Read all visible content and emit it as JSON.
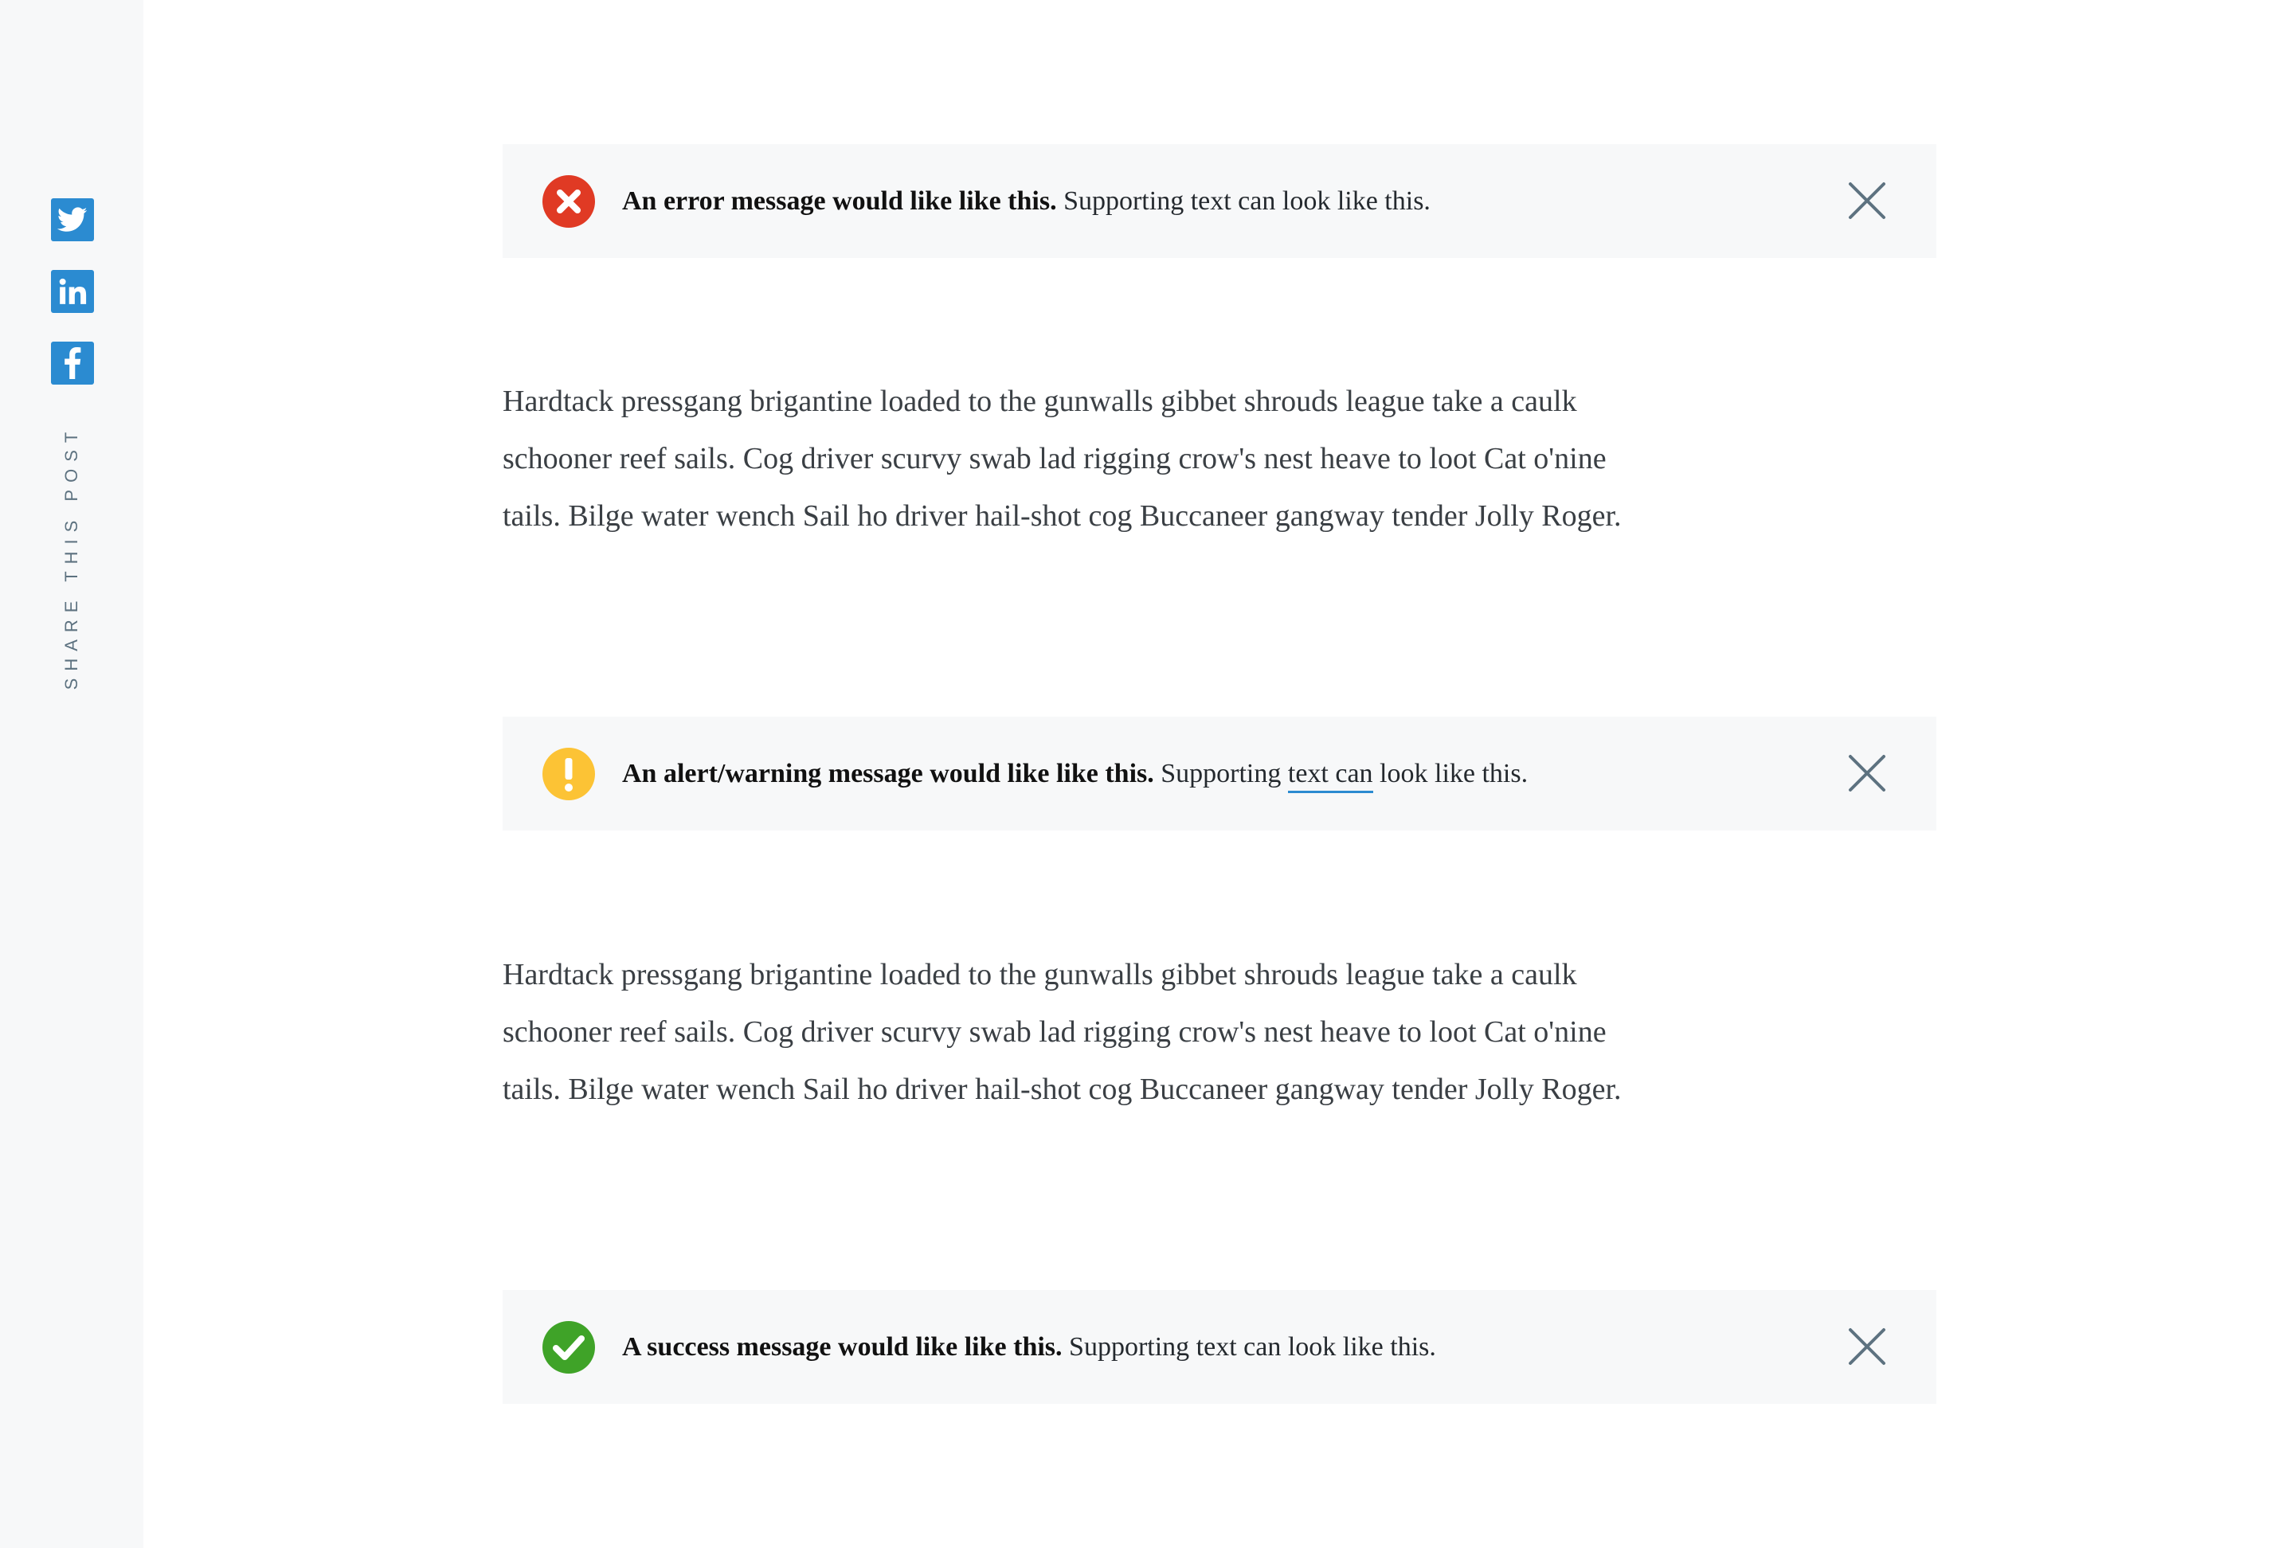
{
  "share": {
    "label": "SHARE THIS POST",
    "icons": [
      "twitter-icon",
      "linkedin-icon",
      "facebook-icon"
    ],
    "color": "#2b8bd1"
  },
  "notices": {
    "error": {
      "title": "An error message would like like this.",
      "text_before": " Supporting text can look like this.",
      "icon": "error-x-icon",
      "color": "#e03a24"
    },
    "warning": {
      "title": "An alert/warning message would like like this.",
      "text_before": " Supporting ",
      "link": "text can",
      "text_after": " look like this.",
      "icon": "warning-exclamation-icon",
      "color": "#fcc335"
    },
    "success": {
      "title": "A success message would like like this.",
      "text_before": " Supporting text can look like this.",
      "icon": "success-check-icon",
      "color": "#3fa328"
    }
  },
  "paragraphs": [
    "Hardtack pressgang brigantine loaded to the gunwalls gibbet shrouds league take a caulk schooner reef sails. Cog driver scurvy swab lad rigging crow's nest heave to loot Cat o'nine tails. Bilge water wench Sail ho driver hail-shot cog Buccaneer gangway tender Jolly Roger.",
    "Hardtack pressgang brigantine loaded to the gunwalls gibbet shrouds league take a caulk schooner reef sails. Cog driver scurvy swab lad rigging crow's nest heave to loot Cat o'nine tails. Bilge water wench Sail ho driver hail-shot cog Buccaneer gangway tender Jolly Roger."
  ],
  "colors": {
    "sidebar_bg": "#f7f8f9",
    "notice_bg": "#f7f8f9",
    "close_icon": "#5d7280",
    "body_text": "#3a3f44"
  }
}
